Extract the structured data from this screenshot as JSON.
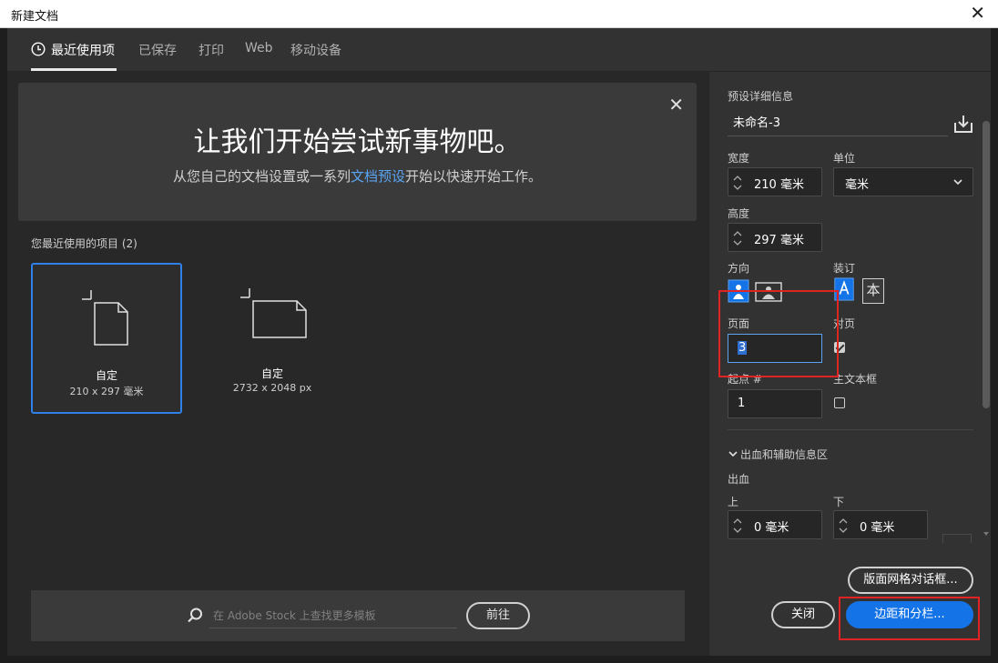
{
  "window": {
    "title": "新建文档",
    "close_glyph": "✕"
  },
  "tabs": [
    {
      "label": "最近使用项",
      "active": true,
      "icon": "clock-icon"
    },
    {
      "label": "已保存",
      "active": false
    },
    {
      "label": "打印",
      "active": false
    },
    {
      "label": "Web",
      "active": false
    },
    {
      "label": "移动设备",
      "active": false
    }
  ],
  "hero": {
    "title": "让我们开始尝试新事物吧。",
    "subtitle_before": "从您自己的文档设置或一系列",
    "subtitle_link": "文档预设",
    "subtitle_after": "开始以快速开始工作。",
    "close_glyph": "✕"
  },
  "recent": {
    "label": "您最近使用的项目 (2)",
    "items": [
      {
        "name": "自定",
        "size": "210 x 297 毫米",
        "selected": true,
        "icon": "portrait-document-icon"
      },
      {
        "name": "自定",
        "size": "2732 x 2048 px",
        "selected": false,
        "icon": "landscape-document-icon"
      }
    ]
  },
  "stock_search": {
    "placeholder": "在 Adobe Stock 上查找更多模板",
    "button_label": "前往"
  },
  "preset_details": {
    "heading": "预设详细信息",
    "document_name": "未命名-3",
    "width_label": "宽度",
    "width_value": "210 毫米",
    "unit_label": "单位",
    "unit_value": "毫米",
    "height_label": "高度",
    "height_value": "297 毫米",
    "orientation_label": "方向",
    "binding_label": "装订",
    "binding_right_glyph": "本",
    "pages_label": "页面",
    "pages_value": "3",
    "facing_label": "对页",
    "facing_checked": true,
    "start_label": "起点 #",
    "start_value": "1",
    "primary_frame_label": "主文本框",
    "primary_frame_checked": false,
    "bleed_section_label": "出血和辅助信息区",
    "bleed_label": "出血",
    "top_label": "上",
    "top_value": "0 毫米",
    "bottom_label": "下",
    "bottom_value": "0 毫米"
  },
  "buttons": {
    "layout_grid": "版面网格对话框...",
    "close": "关闭",
    "margins_columns": "边距和分栏..."
  },
  "colors": {
    "accent": "#1473e6",
    "link": "#5aa4f2",
    "highlight_box": "#e02424"
  }
}
